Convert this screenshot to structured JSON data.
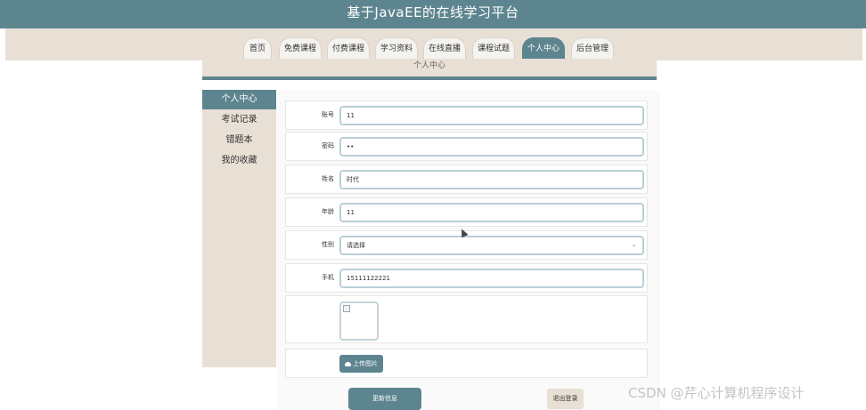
{
  "header": {
    "title": "基于JavaEE的在线学习平台"
  },
  "nav": {
    "items": [
      {
        "label": "首页"
      },
      {
        "label": "免费课程"
      },
      {
        "label": "付费课程"
      },
      {
        "label": "学习资料"
      },
      {
        "label": "在线直播"
      },
      {
        "label": "课程试题"
      },
      {
        "label": "个人中心",
        "active": true
      },
      {
        "label": "后台管理"
      }
    ]
  },
  "section": {
    "title": "个人中心"
  },
  "sidebar": {
    "items": [
      {
        "label": "个人中心",
        "active": true
      },
      {
        "label": "考试记录"
      },
      {
        "label": "错题本"
      },
      {
        "label": "我的收藏"
      }
    ]
  },
  "form": {
    "account": {
      "label": "账号",
      "value": "11"
    },
    "password": {
      "label": "密码",
      "value": "••"
    },
    "name": {
      "label": "姓名",
      "value": "时代"
    },
    "age": {
      "label": "年龄",
      "value": "11"
    },
    "gender": {
      "label": "性别",
      "value": "请选择"
    },
    "phone": {
      "label": "手机",
      "value": "15111122221"
    },
    "upload_label": "上传图片"
  },
  "actions": {
    "update": "更新信息",
    "logout": "退出登录"
  },
  "watermark": "CSDN @芹心计算机程序设计",
  "colors": {
    "primary": "#5d8590",
    "beige": "#e8e0d5"
  }
}
